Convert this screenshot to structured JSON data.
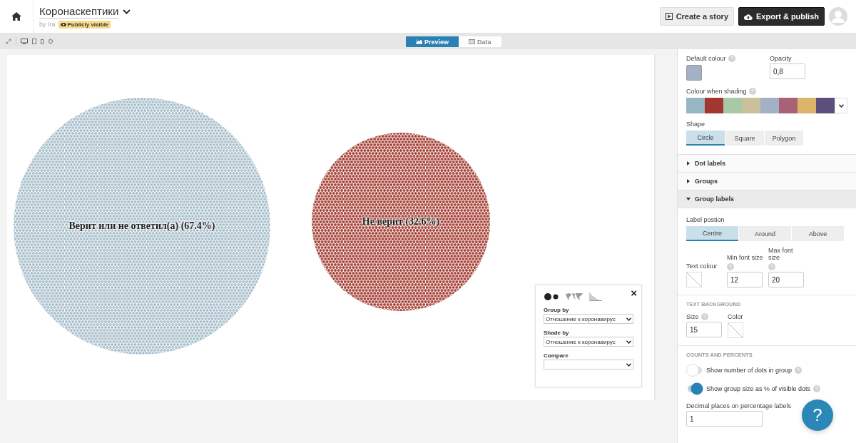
{
  "header": {
    "title": "Коронаскептики",
    "byline": "by Ira",
    "visibility": "Publicly visible",
    "buttons": [
      {
        "label": "Create a story",
        "kind": "story"
      },
      {
        "label": "Export & publish",
        "kind": "export"
      }
    ]
  },
  "view_tabs": [
    {
      "label": "Preview",
      "kind": "chart",
      "selected": true
    },
    {
      "label": "Data",
      "kind": "table",
      "selected": false
    }
  ],
  "chart": {
    "groups": [
      {
        "label": "Верит или не ответил(а) (67.4%)",
        "color": "#a9c0cc"
      },
      {
        "label": "Не верит (32.6%)",
        "color": "#a8453b"
      }
    ]
  },
  "popup": {
    "close": "×",
    "fields": [
      {
        "label": "Group by",
        "value": "Отношение к коронавирус"
      },
      {
        "label": "Shade by",
        "value": "Отношение к коронавирус"
      },
      {
        "label": "Compare"
      }
    ]
  },
  "panel": {
    "default_colour": {
      "label": "Default colour",
      "color": "#a2b1c6"
    },
    "opacity": {
      "label": "Opacity",
      "value": "0,8"
    },
    "shading": {
      "label": "Colour when shading",
      "swatches": [
        {
          "color": "#96b6c3"
        },
        {
          "color": "#a2372f"
        },
        {
          "color": "#a9c8a6"
        },
        {
          "color": "#c9c09c"
        },
        {
          "color": "#a2b1c6"
        },
        {
          "color": "#a96178"
        },
        {
          "color": "#dcb46a"
        },
        {
          "color": "#5d4f7c"
        }
      ]
    },
    "shape": {
      "label": "Shape",
      "options": [
        {
          "label": "Circle",
          "selected": true
        },
        {
          "label": "Square",
          "selected": false
        },
        {
          "label": "Polygon",
          "selected": false
        }
      ]
    },
    "sections": [
      {
        "label": "Dot labels",
        "expanded": false
      },
      {
        "label": "Groups",
        "expanded": false
      },
      {
        "label": "Group labels",
        "expanded": true
      }
    ],
    "label_position": {
      "label": "Label postion",
      "options": [
        {
          "label": "Centre",
          "selected": true
        },
        {
          "label": "Around",
          "selected": false
        },
        {
          "label": "Above",
          "selected": false
        }
      ]
    },
    "text_colour": {
      "label": "Text colour"
    },
    "min_font": {
      "label": "Min font size",
      "value": "12"
    },
    "max_font": {
      "label": "Max font size",
      "value": "20"
    },
    "text_background": {
      "heading": "TEXT BACKGROUND",
      "size_label": "Size",
      "size": "15",
      "color_label": "Color"
    },
    "counts": {
      "heading": "COUNTS AND PERCENTS",
      "toggles": [
        {
          "label": "Show number of dots in group",
          "on": false
        },
        {
          "label": "Show group size as % of visible dots",
          "on": true
        }
      ],
      "decimal_label": "Decimal places on percentage labels",
      "decimal": "1"
    }
  },
  "help": "?"
}
